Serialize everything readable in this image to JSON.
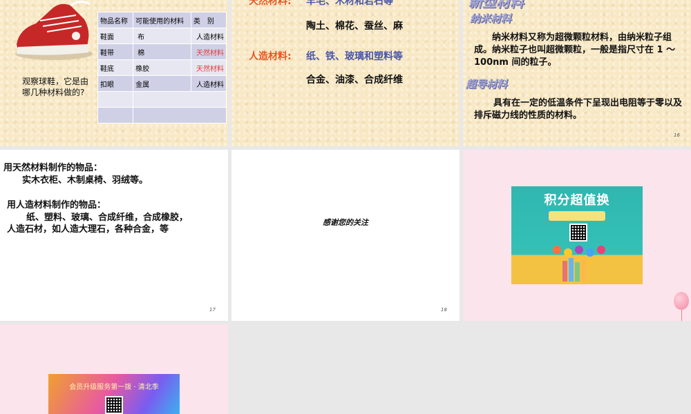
{
  "slide1": {
    "question": "观察球鞋，它是由哪几种材料做的?",
    "table_headers": [
      "物品名称",
      "可能使用的材料",
      "类　别"
    ],
    "rows": [
      {
        "item": "鞋面",
        "material": "布",
        "category": "人造材料"
      },
      {
        "item": "鞋带",
        "material": "棉",
        "category": "天然材料"
      },
      {
        "item": "鞋底",
        "material": "橡胶",
        "category": "天然材料"
      },
      {
        "item": "扣眼",
        "material": "金属",
        "category": "人造材料"
      }
    ]
  },
  "slide2": {
    "natural_label": "天然材料:",
    "natural_items": "羊毛、木材和岩石等",
    "natural_items2": "陶土、棉花、蚕丝、麻",
    "artificial_label": "人造材料:",
    "artificial_items": "纸、铁、玻璃和塑料等",
    "artificial_items2": "合金、油漆、合成纤维"
  },
  "slide3": {
    "title": "新型材料",
    "nano_heading": "纳米材料",
    "nano_text": "纳米材料又称为超微颗粒材料，由纳米粒子组成。纳米粒子也叫超微颗粒，一般是指尺寸在 1 ～ 100nm 间的粒子。",
    "super_heading": "超导材料",
    "super_text": "具有在一定的低温条件下呈现出电阻等于零以及排斥磁力线的性质的材料。",
    "page": "16"
  },
  "slide4": {
    "line1": "用天然材料制作的物品：",
    "line2": "实木衣柜、木制桌椅、羽绒等。",
    "line3": "用人造材料制作的物品：",
    "line4": "纸、塑料、玻璃、合成纤维，合成橡胶，",
    "line5": "人造石材，如人造大理石，各种合金，等",
    "page": "17"
  },
  "slide5": {
    "thanks": "感谢您的关注",
    "page": "18"
  },
  "slide6": {
    "promo_title": "积分超值换"
  },
  "slide7": {
    "vip_text": "会员升级服务第一拨 · 清北季"
  }
}
